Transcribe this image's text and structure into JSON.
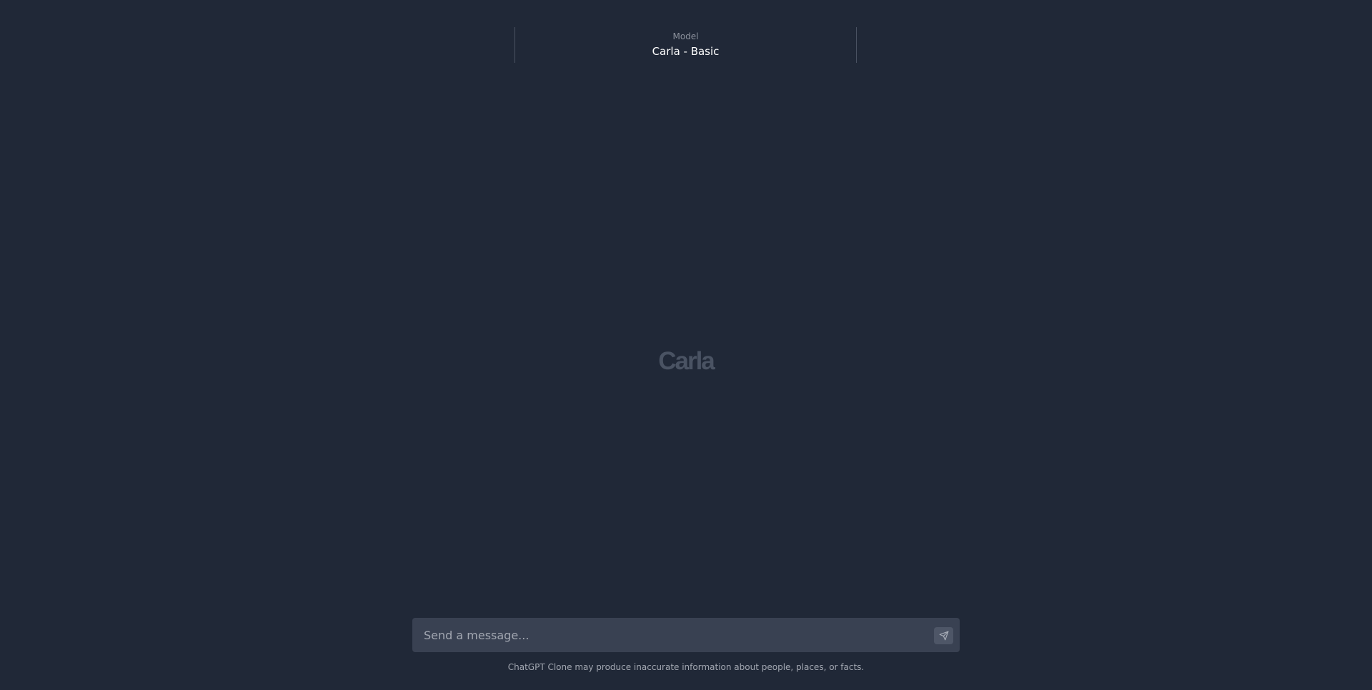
{
  "header": {
    "model_caption": "Model",
    "model_value": "Carla - Basic"
  },
  "main": {
    "brand": "Carla"
  },
  "composer": {
    "placeholder": "Send a message...",
    "value": "",
    "send_icon": "send-icon"
  },
  "footer": {
    "disclaimer": "ChatGPT Clone may produce inaccurate information about people, places, or facts."
  },
  "colors": {
    "background": "#202837",
    "input_background": "#394152",
    "brand_text": "#4a5363"
  }
}
